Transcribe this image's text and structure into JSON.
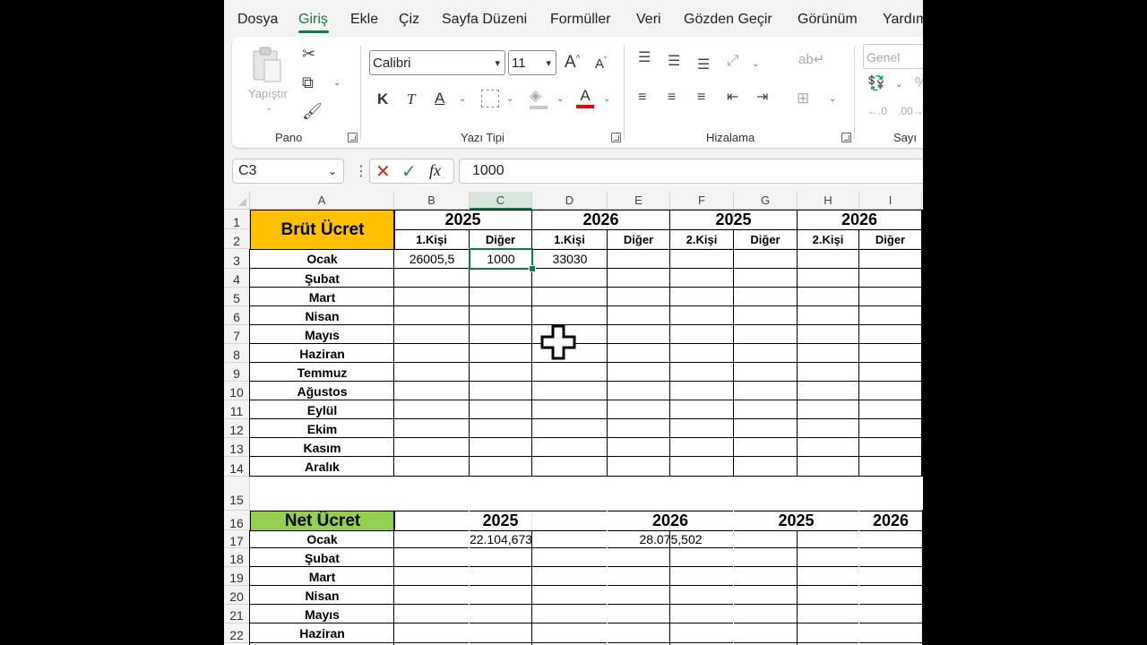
{
  "menu": {
    "items": [
      "Dosya",
      "Giriş",
      "Ekle",
      "Çiz",
      "Sayfa Düzeni",
      "Formüller",
      "Veri",
      "Gözden Geçir",
      "Görünüm",
      "Yardım"
    ],
    "active": "Giriş"
  },
  "ribbon": {
    "pano": {
      "label": "Pano",
      "paste_label": "Yapıştır"
    },
    "font": {
      "label": "Yazı Tipi",
      "font_name": "Calibri",
      "font_size": "11",
      "bold": "K",
      "italic": "T",
      "underline": "A",
      "font_color": "A",
      "grow": "A",
      "shrink": "A"
    },
    "align": {
      "label": "Hizalama"
    },
    "number": {
      "label": "Sayı",
      "format": "Genel"
    },
    "accent_color": "#107c41"
  },
  "formula_bar": {
    "name_box": "C3",
    "fx": "fx",
    "value": "1000"
  },
  "grid": {
    "columns": [
      "A",
      "B",
      "C",
      "D",
      "E",
      "F",
      "G",
      "H",
      "I"
    ],
    "selected_column": "C",
    "rows": [
      "1",
      "2",
      "3",
      "4",
      "5",
      "6",
      "7",
      "8",
      "9",
      "10",
      "11",
      "12",
      "13",
      "14",
      "15",
      "16",
      "17",
      "18",
      "19",
      "20",
      "21",
      "22"
    ],
    "table1": {
      "title": "Brüt Ücret",
      "title_color": "#ffc000",
      "years": [
        "2025",
        "2026",
        "2025",
        "2026"
      ],
      "subheaders": [
        "1.Kişi",
        "Diğer",
        "1.Kişi",
        "Diğer",
        "2.Kişi",
        "Diğer",
        "2.Kişi",
        "Diğer"
      ],
      "months": [
        "Ocak",
        "Şubat",
        "Mart",
        "Nisan",
        "Mayıs",
        "Haziran",
        "Temmuz",
        "Ağustos",
        "Eylül",
        "Ekim",
        "Kasım",
        "Aralık"
      ],
      "values_row3": [
        "26005,5",
        "1000",
        "33030"
      ]
    },
    "table2": {
      "title": "Net Ücret",
      "title_color": "#92d050",
      "years": [
        "2025",
        "2026",
        "2025",
        "2026"
      ],
      "months": [
        "Ocak",
        "Şubat",
        "Mart",
        "Nisan",
        "Mayıs",
        "Haziran"
      ],
      "values_row17": [
        "22.104,673",
        "28.075,502"
      ]
    }
  }
}
